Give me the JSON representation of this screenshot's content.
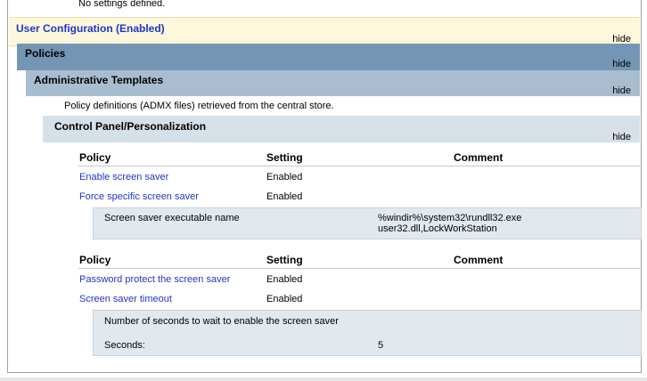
{
  "top": {
    "no_settings": "No settings defined."
  },
  "user_config": {
    "title": "User Configuration (Enabled)",
    "hide": "hide"
  },
  "policies": {
    "title": "Policies",
    "hide": "hide"
  },
  "admin_templates": {
    "title": "Administrative Templates",
    "hide": "hide",
    "note": "Policy definitions (ADMX files) retrieved from the central store."
  },
  "control_panel": {
    "title": "Control Panel/Personalization",
    "hide": "hide"
  },
  "table1": {
    "headers": [
      "Policy",
      "Setting",
      "Comment"
    ],
    "rows": [
      {
        "policy": "Enable screen saver",
        "setting": "Enabled"
      },
      {
        "policy": "Force specific screen saver",
        "setting": "Enabled"
      }
    ],
    "detail": {
      "label": "Screen saver executable name",
      "value_line1": "%windir%\\system32\\rundll32.exe",
      "value_line2": "user32.dll,LockWorkStation"
    }
  },
  "table2": {
    "headers": [
      "Policy",
      "Setting",
      "Comment"
    ],
    "rows": [
      {
        "policy": "Password protect the screen saver",
        "setting": "Enabled"
      },
      {
        "policy": "Screen saver timeout",
        "setting": "Enabled"
      }
    ],
    "detail": {
      "label": "Number of seconds to wait to enable the screen saver",
      "seconds_label": "Seconds:",
      "seconds_value": "5"
    }
  },
  "colors": {
    "link": "#2035c8",
    "user_config_bg": "#fdf8dc",
    "policies_bg": "#7496b4",
    "admin_bg": "#a9bdd0",
    "control_bg": "#d6e0e8",
    "detail_bg": "#e1e9ef"
  }
}
